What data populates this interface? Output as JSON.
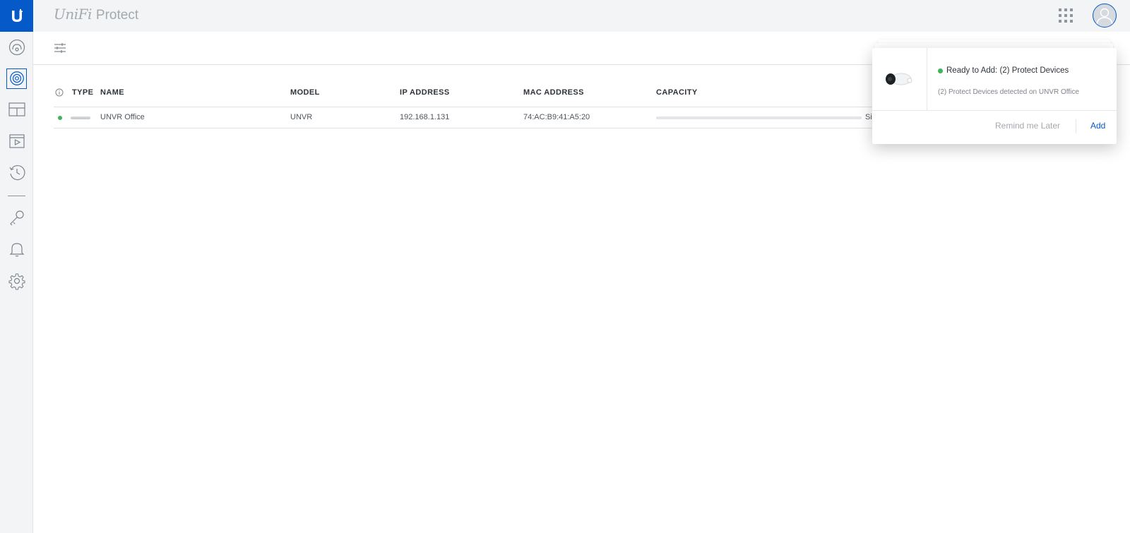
{
  "app": {
    "brand_main": "UniFi",
    "brand_product": "Protect"
  },
  "sidebar": {
    "items": [
      {
        "icon": "speedometer-icon"
      },
      {
        "icon": "camera-lens-icon",
        "active": true
      },
      {
        "icon": "grid-layout-icon"
      },
      {
        "icon": "video-player-icon"
      },
      {
        "icon": "history-icon"
      },
      {
        "icon": "key-icon"
      },
      {
        "icon": "bell-icon"
      },
      {
        "icon": "gear-icon"
      }
    ]
  },
  "header": {
    "apps_icon": "grid-dots-icon",
    "avatar_icon": "user-icon"
  },
  "table": {
    "columns": {
      "type": "TYPE",
      "name": "NAME",
      "model": "MODEL",
      "ip": "IP ADDRESS",
      "mac": "MAC ADDRESS",
      "capacity": "CAPACITY"
    },
    "rows": [
      {
        "name": "UNVR Office",
        "model": "UNVR",
        "ip": "192.168.1.131",
        "mac": "74:AC:B9:41:A5:20",
        "capacity_text": "Si",
        "status": "online"
      }
    ]
  },
  "notification": {
    "title": "Ready to Add: (2) Protect Devices",
    "description": "(2) Protect Devices detected on UNVR Office",
    "remind_label": "Remind me Later",
    "add_label": "Add"
  },
  "colors": {
    "accent": "#0559c9",
    "online": "#3fb35c"
  }
}
